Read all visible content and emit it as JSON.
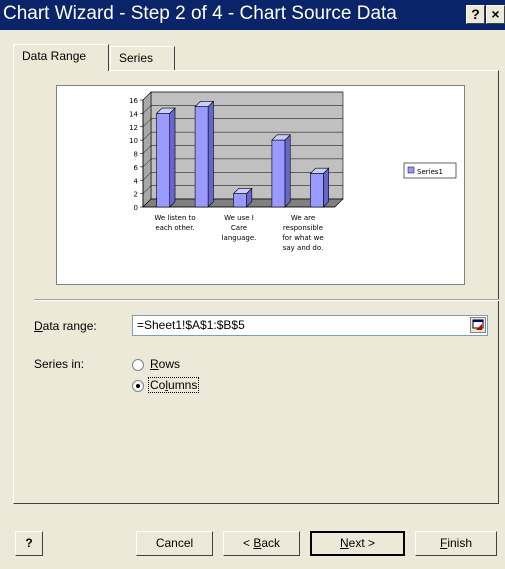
{
  "window": {
    "title": "Chart Wizard - Step 2 of 4 - Chart Source Data",
    "help_button": "?",
    "close_button": "×"
  },
  "tabs": [
    {
      "label": "Data Range",
      "active": true
    },
    {
      "label": "Series",
      "active": false
    }
  ],
  "chart_data": {
    "type": "bar",
    "categories": [
      "We listen to each other.",
      "We use I Care language.",
      "We are responsible for what we say and do."
    ],
    "category_label_lines": [
      [
        "We listen to",
        "each other."
      ],
      [
        "We use I",
        "Care",
        "language."
      ],
      [
        "We are",
        "responsible",
        "for what we",
        "say and do."
      ]
    ],
    "series": [
      {
        "name": "Series1",
        "values": [
          14,
          15,
          2,
          10,
          5
        ]
      }
    ],
    "y_ticks": [
      "0",
      "2",
      "4",
      "6",
      "8",
      "10",
      "12",
      "14",
      "16"
    ],
    "ylim": [
      0,
      16
    ],
    "grid": true,
    "legend": "right",
    "colors": {
      "bar": "#9999ff",
      "wall": "#c0c0c0"
    }
  },
  "form": {
    "data_range_label": "Data range:",
    "data_range_value": "=Sheet1!$A$1:$B$5",
    "series_in_label": "Series in:",
    "rows_label": "Rows",
    "columns_label": "Columns",
    "series_in_selected": "Columns"
  },
  "buttons": {
    "help": "?",
    "cancel": "Cancel",
    "back": "< Back",
    "next": "Next >",
    "finish": "Finish"
  }
}
